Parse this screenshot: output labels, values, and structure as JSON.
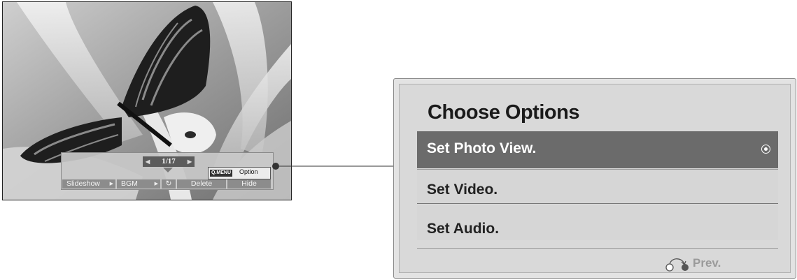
{
  "photo": {
    "counter": "1/17",
    "counter_prev_icon": "left-triangle-icon",
    "counter_next_icon": "right-triangle-icon",
    "qmenu_badge": "Q.MENU",
    "qmenu_label": "Option",
    "toolbar": {
      "slideshow": "Slideshow",
      "bgm": "BGM",
      "rotate_icon": "rotate-icon",
      "delete": "Delete",
      "hide": "Hide"
    }
  },
  "dialog": {
    "title": "Choose Options",
    "options": [
      {
        "label": "Set Photo View.",
        "selected": true
      },
      {
        "label": "Set Video.",
        "selected": false
      },
      {
        "label": "Set Audio.",
        "selected": false
      }
    ],
    "prev_label": "Prev.",
    "prev_icon": "back-return-icon"
  },
  "colors": {
    "selected_row": "#6b6b6b",
    "dialog_bg": "#d9d9d9",
    "toolbar_button": "#8c8c8c"
  }
}
